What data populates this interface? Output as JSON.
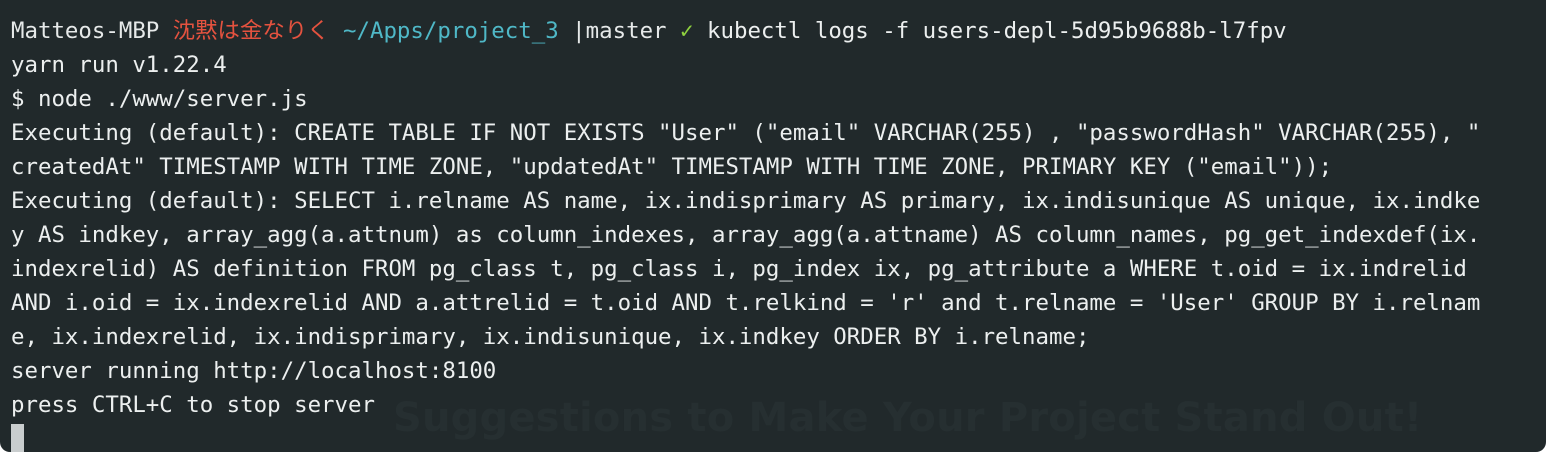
{
  "prompt": {
    "host": "Matteos-MBP",
    "theme_text": "沈黙は金なりく",
    "path": "~/Apps/project_3",
    "branch": "|master",
    "status_glyph": "✓",
    "command": "kubectl logs -f users-depl-5d95b9688b-l7fpv"
  },
  "output_lines": [
    "yarn run v1.22.4",
    "$ node ./www/server.js",
    "Executing (default): CREATE TABLE IF NOT EXISTS \"User\" (\"email\" VARCHAR(255) , \"passwordHash\" VARCHAR(255), \"",
    "createdAt\" TIMESTAMP WITH TIME ZONE, \"updatedAt\" TIMESTAMP WITH TIME ZONE, PRIMARY KEY (\"email\"));",
    "Executing (default): SELECT i.relname AS name, ix.indisprimary AS primary, ix.indisunique AS unique, ix.indke",
    "y AS indkey, array_agg(a.attnum) as column_indexes, array_agg(a.attname) AS column_names, pg_get_indexdef(ix.",
    "indexrelid) AS definition FROM pg_class t, pg_class i, pg_index ix, pg_attribute a WHERE t.oid = ix.indrelid",
    "AND i.oid = ix.indexrelid AND a.attrelid = t.oid AND t.relkind = 'r' and t.relname = 'User' GROUP BY i.relnam",
    "e, ix.indexrelid, ix.indisprimary, ix.indisunique, ix.indkey ORDER BY i.relname;",
    "server running http://localhost:8100",
    "press CTRL+C to stop server"
  ],
  "overlay_text": "Suggestions to Make Your Project Stand Out!",
  "colors": {
    "background": "#21292b",
    "text": "#ecefef",
    "theme_text": "#e4523f",
    "path": "#4fb8c7",
    "check": "#8fd13f"
  }
}
